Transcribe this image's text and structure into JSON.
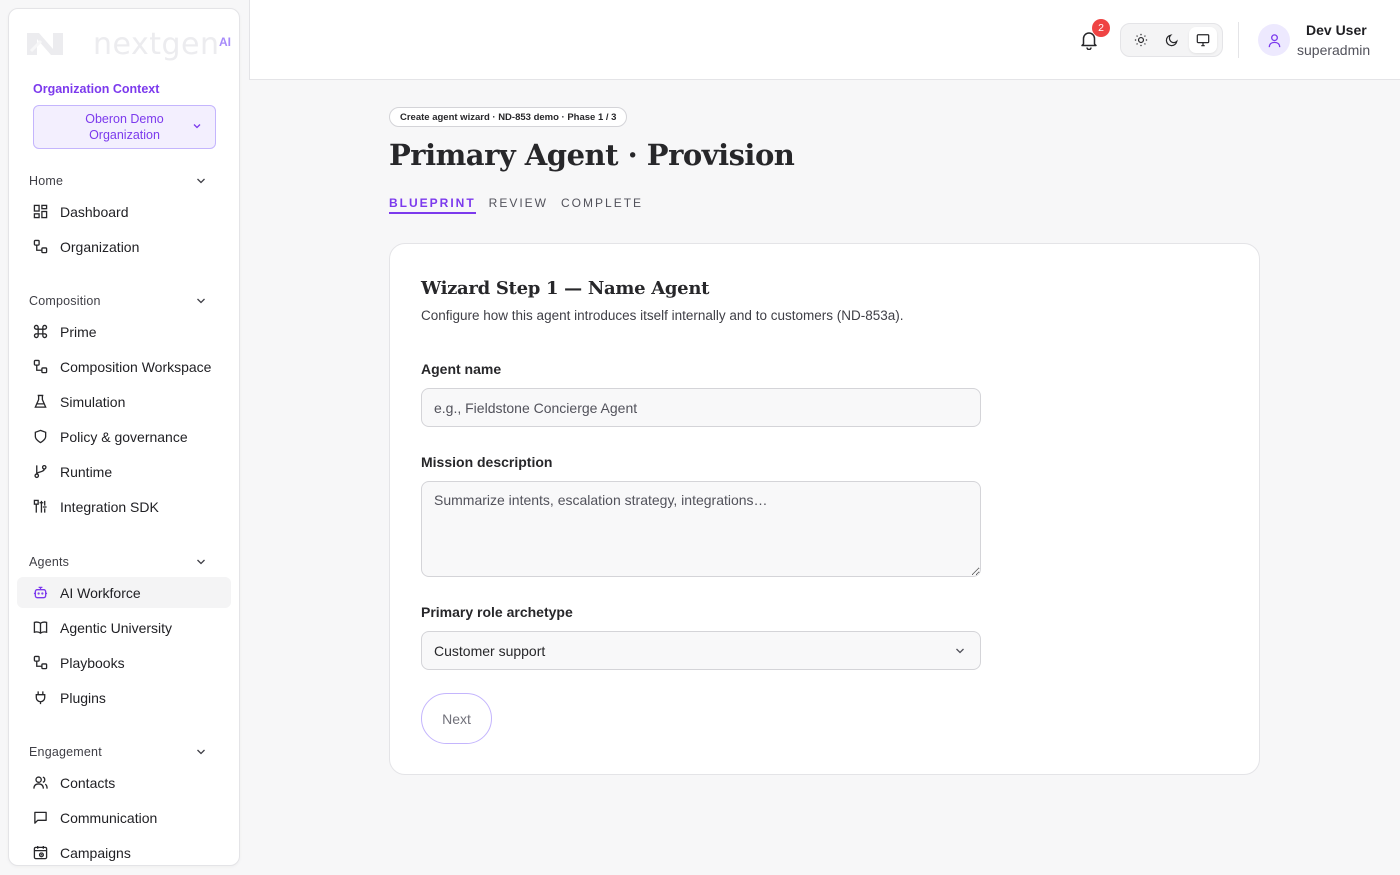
{
  "brand": {
    "logo_text": "nextgen",
    "logo_suffix": "AI"
  },
  "org": {
    "label": "Organization Context",
    "selected": "Oberon Demo Organization"
  },
  "sidebar": {
    "sections": [
      {
        "title": "Home",
        "items": [
          {
            "label": "Dashboard",
            "icon": "dashboard-icon"
          },
          {
            "label": "Organization",
            "icon": "workflow-icon"
          }
        ]
      },
      {
        "title": "Composition",
        "items": [
          {
            "label": "Prime",
            "icon": "command-icon"
          },
          {
            "label": "Composition Workspace",
            "icon": "workflow-icon"
          },
          {
            "label": "Simulation",
            "icon": "flask-icon"
          },
          {
            "label": "Policy & governance",
            "icon": "shield-icon"
          },
          {
            "label": "Runtime",
            "icon": "git-branch-icon"
          },
          {
            "label": "Integration SDK",
            "icon": "sdk-icon"
          }
        ]
      },
      {
        "title": "Agents",
        "items": [
          {
            "label": "AI Workforce",
            "icon": "bot-icon",
            "active": true
          },
          {
            "label": "Agentic University",
            "icon": "book-icon"
          },
          {
            "label": "Playbooks",
            "icon": "workflow-icon"
          },
          {
            "label": "Plugins",
            "icon": "plug-icon"
          }
        ]
      },
      {
        "title": "Engagement",
        "items": [
          {
            "label": "Contacts",
            "icon": "users-icon"
          },
          {
            "label": "Communication",
            "icon": "message-icon"
          },
          {
            "label": "Campaigns",
            "icon": "calendar-icon"
          }
        ]
      }
    ]
  },
  "header": {
    "notification_count": "2",
    "theme_options": [
      "light",
      "dark",
      "system"
    ],
    "theme_selected": "system",
    "user_name": "Dev User",
    "user_role": "superadmin"
  },
  "main": {
    "breadcrumb": "Create agent wizard · ND-853 demo · Phase 1 / 3",
    "title": "Primary Agent · Provision",
    "steps": [
      "BLUEPRINT",
      "REVIEW",
      "COMPLETE"
    ],
    "active_step": "BLUEPRINT",
    "card": {
      "title": "Wizard Step 1 — Name Agent",
      "subtitle": "Configure how this agent introduces itself internally and to customers (ND-853a).",
      "agent_name_label": "Agent name",
      "agent_name_value": "",
      "agent_name_placeholder": "e.g., Fieldstone Concierge Agent",
      "mission_label": "Mission description",
      "mission_value": "",
      "mission_placeholder": "Summarize intents, escalation strategy, integrations…",
      "role_label": "Primary role archetype",
      "role_value": "Customer support",
      "next_label": "Next"
    }
  },
  "colors": {
    "accent": "#7c3aed",
    "badge": "#ef4444"
  }
}
